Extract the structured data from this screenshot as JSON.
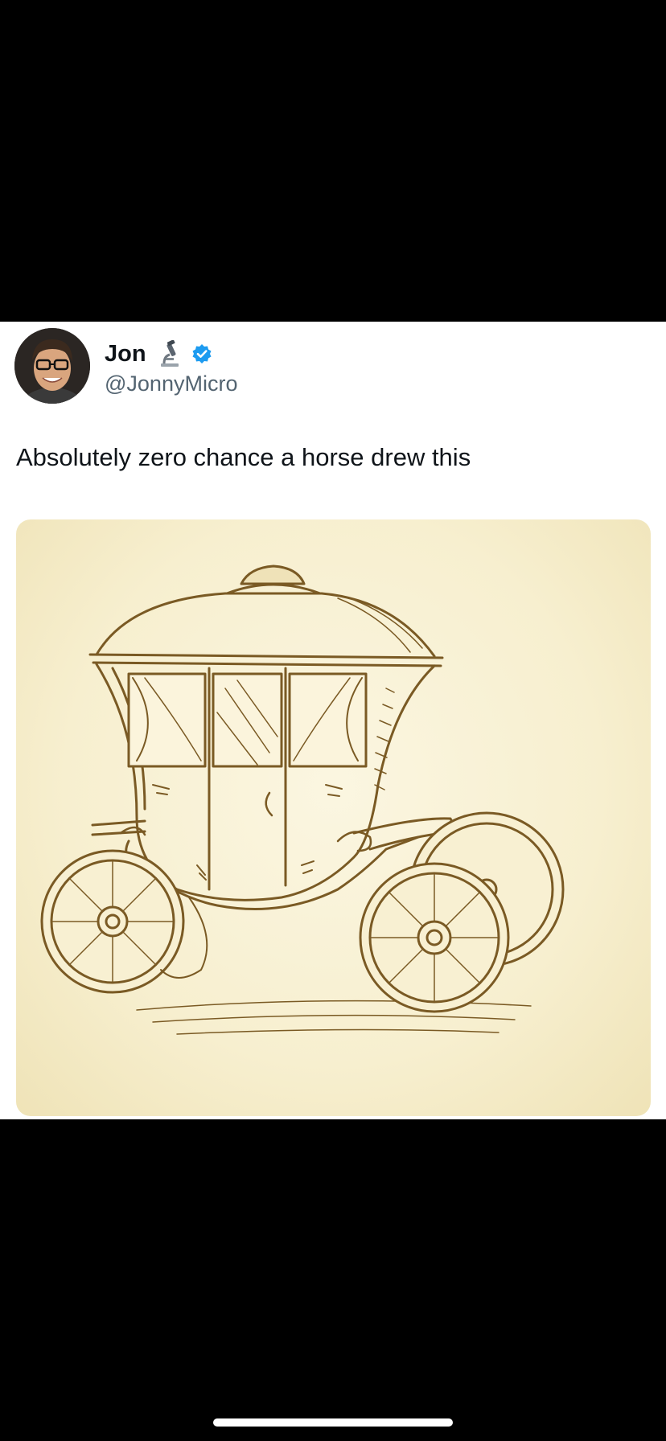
{
  "tweet": {
    "author": {
      "display_name": "Jon",
      "handle": "@JonnyMicro",
      "name_emoji_icon": "microscope-icon",
      "verified_icon": "verified-badge-icon"
    },
    "text": "Absolutely zero chance a horse drew this",
    "media": {
      "subject": "carriage-drawing"
    }
  },
  "colors": {
    "verified_blue": "#1d9bf0",
    "sketch_brown": "#7a5a24",
    "paper_cream": "#f7efcf"
  }
}
